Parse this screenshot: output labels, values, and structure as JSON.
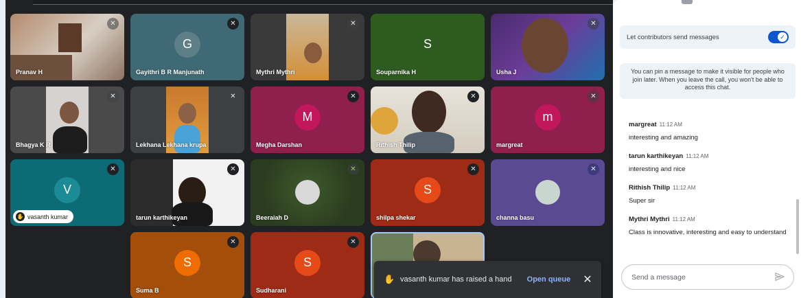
{
  "participants": [
    {
      "name": "Pranav H"
    },
    {
      "name": "Gayithri B R Manjunath",
      "initial": "G"
    },
    {
      "name": "Mythri Mythri"
    },
    {
      "name": "Souparnika H",
      "initial": "S"
    },
    {
      "name": "Usha J"
    },
    {
      "name": "Bhagya K R"
    },
    {
      "name": "Lekhana Lekhana krupa"
    },
    {
      "name": "Megha Darshan",
      "initial": "M"
    },
    {
      "name": "Rithish Thilip"
    },
    {
      "name": "margreat",
      "initial": "m"
    },
    {
      "name": "vasanth kumar",
      "initial": "V"
    },
    {
      "name": "tarun karthikeyan"
    },
    {
      "name": "Beeraiah D"
    },
    {
      "name": "shilpa shekar",
      "initial": "S"
    },
    {
      "name": "channa basu"
    },
    {
      "name": "Suma B",
      "initial": "S"
    },
    {
      "name": "Sudharani",
      "initial": "S"
    }
  ],
  "toast": {
    "message": "vasanth kumar has raised a hand",
    "action": "Open queue"
  },
  "chat": {
    "toggle_label": "Let contributors send messages",
    "info": "You can pin a message to make it visible for people who join later. When you leave the call, you won't be able to access this chat.",
    "messages": [
      {
        "sender": "margreat",
        "time": "11:12 AM",
        "text": "interesting and amazing"
      },
      {
        "sender": "tarun karthikeyan",
        "time": "11:12 AM",
        "text": "interesting and nice"
      },
      {
        "sender": "Rithish Thilip",
        "time": "11:12 AM",
        "text": "Super sir"
      },
      {
        "sender": "Mythri Mythri",
        "time": "11:12 AM",
        "text": "Class is innovative, interesting and easy to understand"
      }
    ],
    "input_placeholder": "Send a message"
  }
}
